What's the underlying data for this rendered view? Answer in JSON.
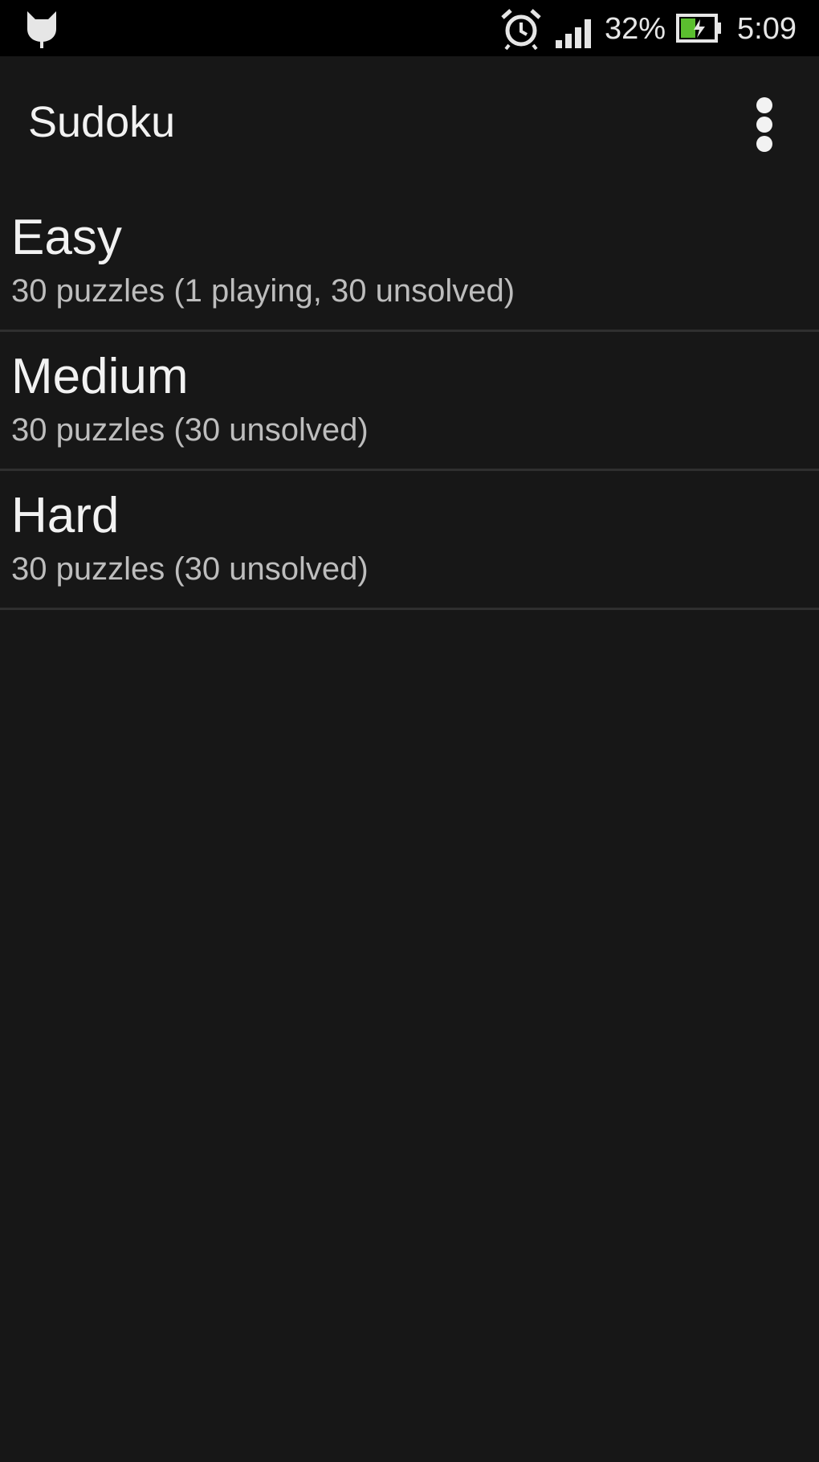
{
  "status_bar": {
    "notification_icon": "cat-head-icon",
    "alarm_icon": "alarm-clock-icon",
    "signal_icon": "cell-signal-icon",
    "battery_percent": "32%",
    "battery_icon": "battery-charging-icon",
    "time": "5:09"
  },
  "app_bar": {
    "title": "Sudoku",
    "menu_icon": "overflow-menu-icon"
  },
  "levels": [
    {
      "title": "Easy",
      "subtitle": "30 puzzles (1 playing, 30 unsolved)"
    },
    {
      "title": "Medium",
      "subtitle": "30 puzzles (30 unsolved)"
    },
    {
      "title": "Hard",
      "subtitle": "30 puzzles (30 unsolved)"
    }
  ],
  "colors": {
    "background": "#171717",
    "status_bar": "#000000",
    "text_primary": "#f2f2f2",
    "text_secondary": "#bdbdbd",
    "divider": "#2f2f2f",
    "battery_fill": "#5bbf2f"
  }
}
